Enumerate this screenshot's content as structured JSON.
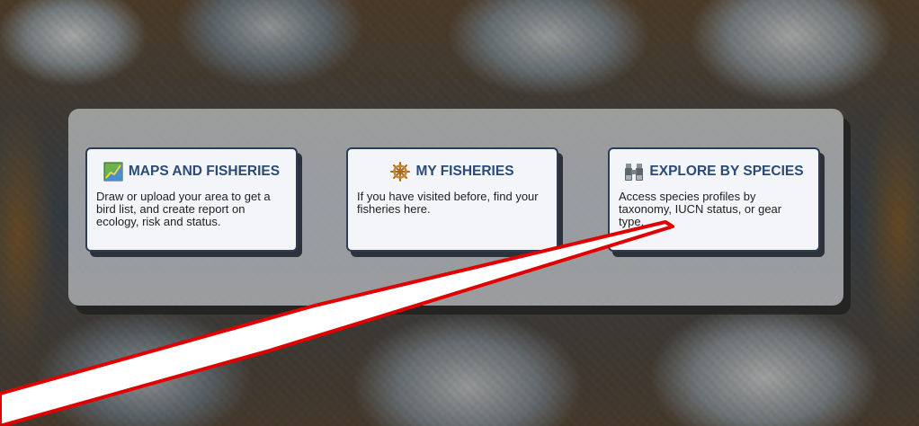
{
  "cards": [
    {
      "title": "MAPS AND FISHERIES",
      "icon": "map-icon",
      "description": "Draw or upload your area to get a bird list, and create report on ecology, risk and status."
    },
    {
      "title": "MY FISHERIES",
      "icon": "ship-wheel-icon",
      "description": "If you have visited before, find your fisheries here."
    },
    {
      "title": "EXPLORE BY SPECIES",
      "icon": "binoculars-icon",
      "description": "Access species profiles by taxonomy, IUCN status, or gear type."
    }
  ],
  "colors": {
    "title": "#2b4a78",
    "card_border": "#2a3d5a",
    "annotation": "#e00000"
  }
}
